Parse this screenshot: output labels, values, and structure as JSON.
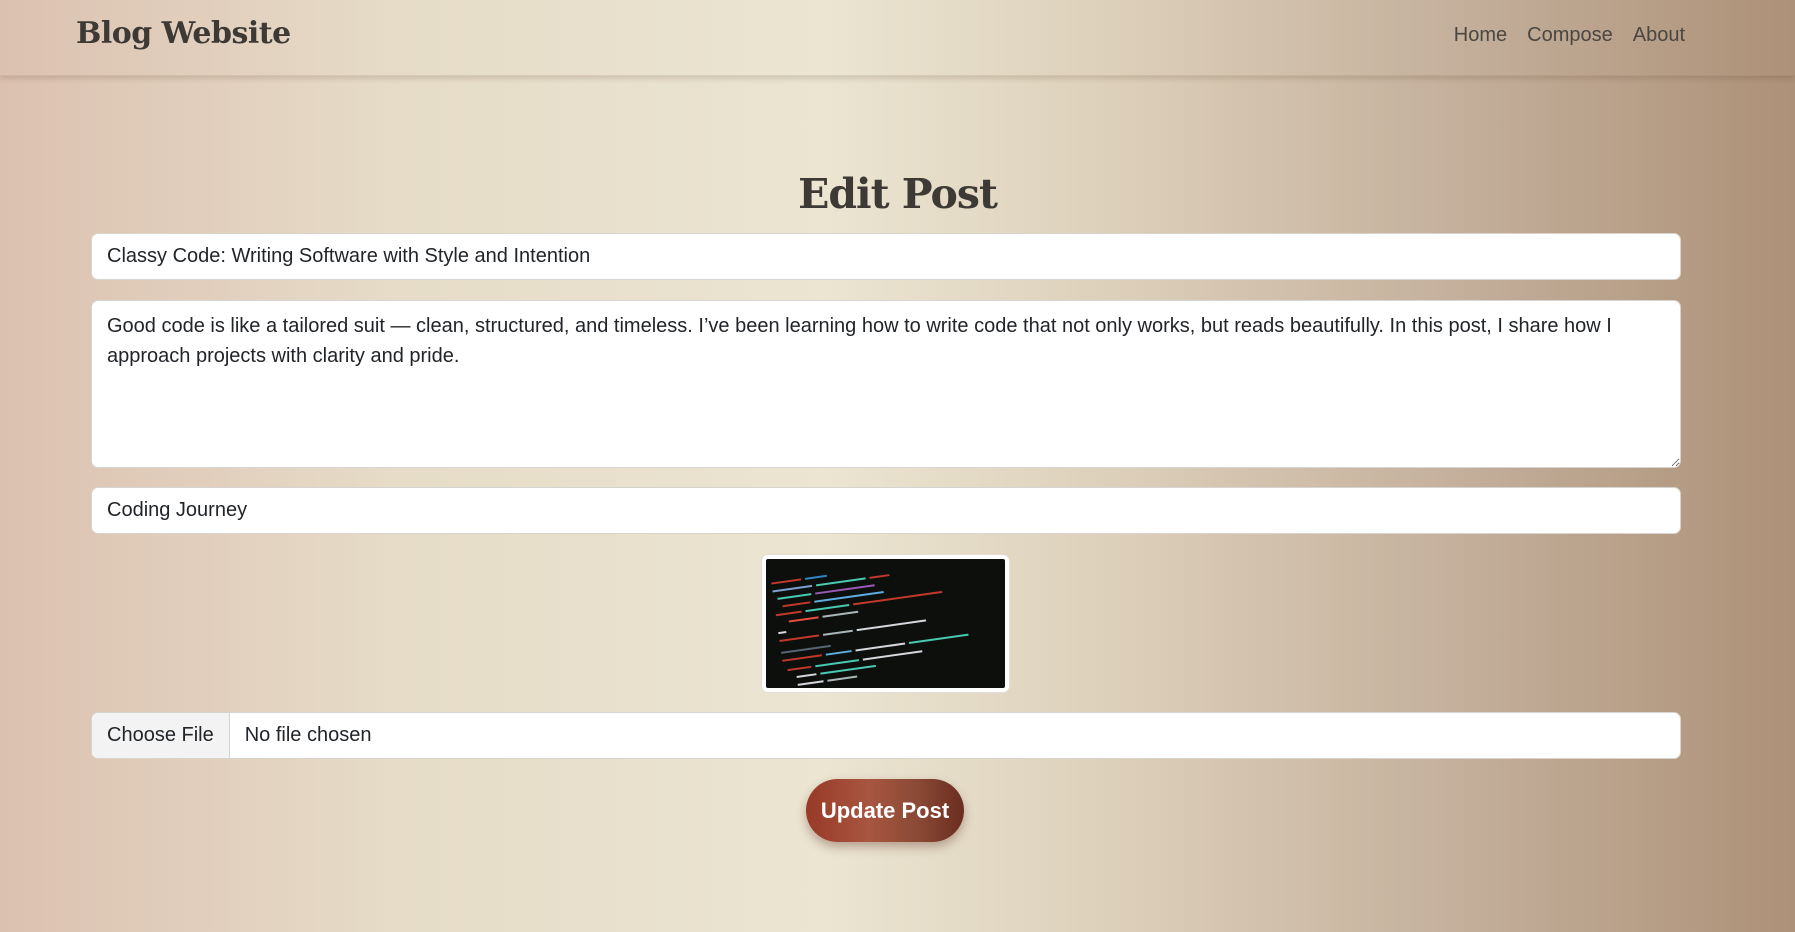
{
  "navbar": {
    "brand": "Blog Website",
    "links": [
      "Home",
      "Compose",
      "About"
    ]
  },
  "page": {
    "title": "Edit Post"
  },
  "form": {
    "post_title": "Classy Code: Writing Software with Style and Intention",
    "content": "Good code is like a tailored suit — clean, structured, and timeless. I’ve been learning how to write code that not only works, but reads beautifully. In this post, I share how I approach projects with clarity and pride.",
    "category": "Coding Journey",
    "file_button_label": "Choose File",
    "file_status": "No file chosen",
    "submit_label": "Update Post"
  },
  "colors": {
    "accent": "#983a28",
    "heading": "#3d3a36"
  }
}
